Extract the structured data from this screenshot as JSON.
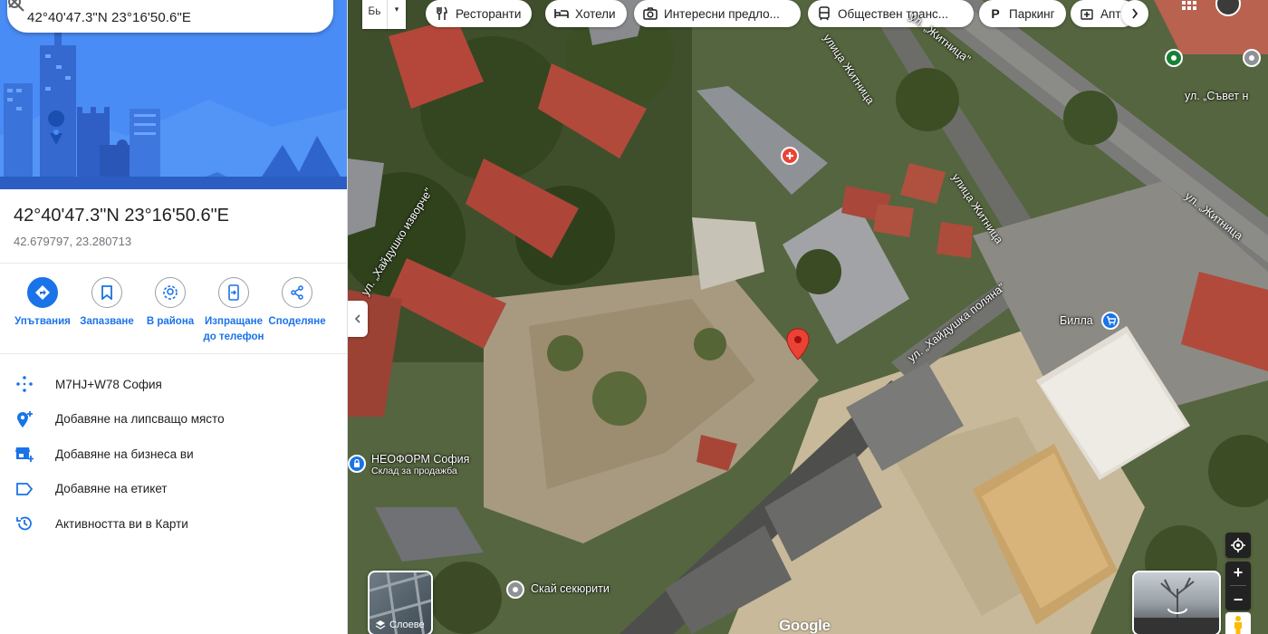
{
  "search": {
    "value": "42°40'47.3\"N 23°16'50.6\"E",
    "search_icon": "search-icon",
    "close_icon": "close-icon"
  },
  "place": {
    "title": "42°40'47.3\"N 23°16'50.6\"E",
    "decimal": "42.679797, 23.280713"
  },
  "actions": [
    {
      "label": "Упътвания",
      "icon": "directions-icon"
    },
    {
      "label": "Запазване",
      "icon": "bookmark-icon"
    },
    {
      "label": "В района",
      "icon": "nearby-icon"
    },
    {
      "label": "Изпращане до телефон",
      "icon": "send-to-phone-icon"
    },
    {
      "label": "Споделяне",
      "icon": "share-icon"
    }
  ],
  "info_list": [
    {
      "label": "M7HJ+W78 София",
      "icon": "plus-code-icon"
    },
    {
      "label": "Добавяне на липсващо място",
      "icon": "add-place-icon"
    },
    {
      "label": "Добавяне на бизнеса ви",
      "icon": "add-business-icon"
    },
    {
      "label": "Добавяне на етикет",
      "icon": "label-icon"
    },
    {
      "label": "Активността ви в Карти",
      "icon": "history-icon"
    }
  ],
  "map": {
    "language_short": "Бь",
    "chips": [
      {
        "label": "Ресторанти",
        "icon": "restaurant-icon"
      },
      {
        "label": "Хотели",
        "icon": "hotel-icon"
      },
      {
        "label": "Интересни предло...",
        "icon": "camera-icon"
      },
      {
        "label": "Обществен транс...",
        "icon": "transit-icon"
      },
      {
        "label": "Паркинг",
        "icon": "parking-icon"
      },
      {
        "label": "Апт",
        "icon": "pharmacy-icon"
      }
    ],
    "streets": [
      "улица Житница",
      "улица Житница",
      "ул. „Хайдушко изворче\"",
      "ул. „Хайдушка поляна\"",
      "ул. „Съвет н",
      "ул. „Житница",
      "ул. „Житница\""
    ],
    "pois": {
      "billa": "Билла",
      "neoform": "НЕОФОРМ София",
      "neoform_sub": "Склад за продажба",
      "sky": "Скай секюрити"
    },
    "layers_label": "Слоеве",
    "google": "Google",
    "colors": {
      "marker": "#ea4335",
      "accent": "#1a73e8",
      "hero": "#4285f4"
    }
  }
}
